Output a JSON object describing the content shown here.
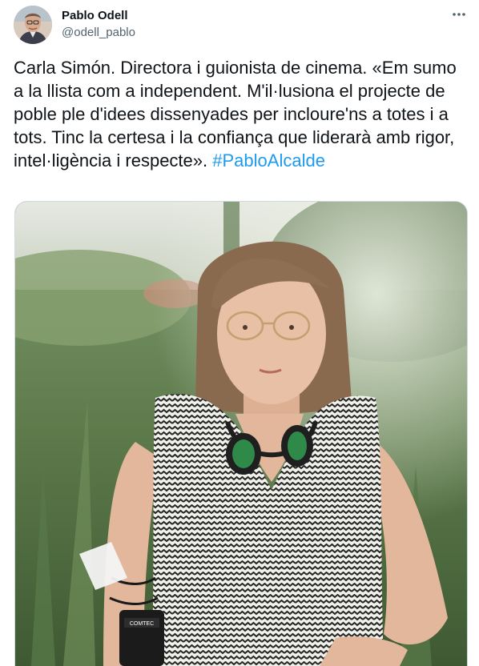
{
  "author": {
    "name": "Pablo Odell",
    "handle": "@odell_pablo"
  },
  "more_icon": "more-horizontal-icon",
  "tweet": {
    "text": "Carla Simón. Directora i guionista de cinema. «Em sumo a la llista com a independent. M'il·lusiona el projecte de poble ple d'idees dissenyades per incloure'ns a totes i a tots. Tinc la certesa i la confiança que liderarà amb rigor, intel·ligència i respecte».",
    "hashtag": "#PabloAlcalde"
  },
  "photo": {
    "headphone_brand": "COMTEC"
  },
  "colors": {
    "link": "#1d9bf0",
    "secondary_text": "#536471",
    "primary_text": "#0f1419",
    "border": "#cfd9de"
  }
}
